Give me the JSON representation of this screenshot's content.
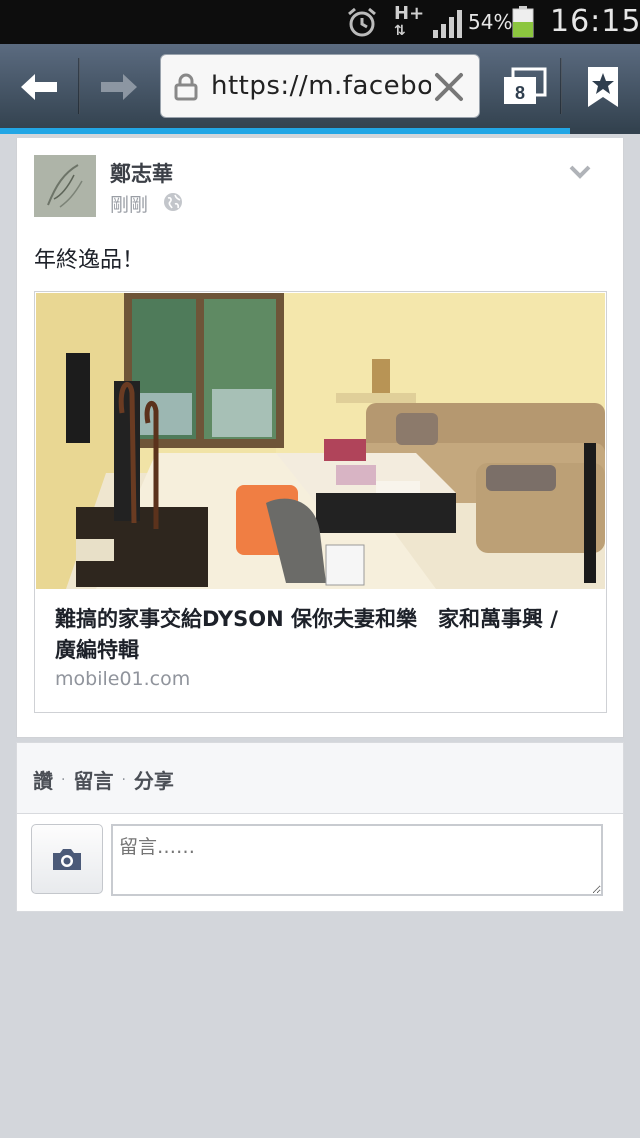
{
  "status_bar": {
    "network": "H+",
    "battery_percent": "54%",
    "time": "16:15",
    "icons": [
      "alarm-icon",
      "network-arrows-icon",
      "signal-icon",
      "battery-icon"
    ]
  },
  "browser": {
    "url": "https://m.facebook.com",
    "tab_count": "8",
    "page_load_progress": 0.89,
    "icons": [
      "back-arrow-icon",
      "forward-arrow-icon",
      "lock-icon",
      "clear-icon",
      "tabs-icon",
      "bookmark-star-icon"
    ]
  },
  "post": {
    "author": "鄭志華",
    "time": "剛剛",
    "text": "年終逸品！",
    "link": {
      "title": "難搞的家事交給DYSON 保你夫妻和樂　家和萬事興 / 廣編特輯",
      "domain": "mobile01.com"
    }
  },
  "actions": {
    "like": "讚",
    "separator": "·",
    "comment": "留言",
    "share": "分享"
  },
  "composer": {
    "placeholder": "留言……"
  },
  "colors": {
    "toolbar": "#3e4d5e",
    "progress": "#22a6e5",
    "background": "#d3d6db",
    "camera_icon": "#4b5a78"
  }
}
